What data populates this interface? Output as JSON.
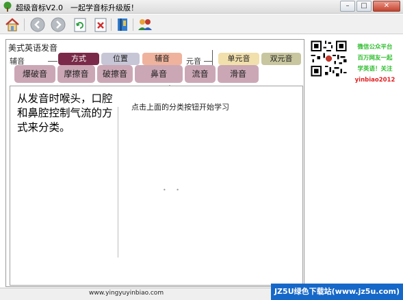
{
  "window": {
    "title": "超级音标V2.0　一起学音标升级版！",
    "minimize": "–",
    "maximize": "□",
    "close": "✕"
  },
  "toolbar": {
    "icons": [
      "home-icon",
      "back-icon",
      "forward-icon",
      "refresh-icon",
      "delete-icon",
      "book-icon",
      "users-icon"
    ]
  },
  "panel": {
    "section_title": "美式英语发音",
    "consonant_label": "辅音",
    "vowel_label": "元音",
    "consonant_tabs": [
      "方式",
      "位置",
      "辅音"
    ],
    "vowel_tabs": [
      "单元音",
      "双元音"
    ],
    "manner_buttons": [
      "爆破音",
      "摩擦音",
      "破擦音",
      "鼻音",
      "流音",
      "滑音"
    ]
  },
  "content": {
    "description": "从发音时喉头，口腔和鼻腔控制气流的方式来分类。",
    "hint": "点击上面的分类按钮开始学习"
  },
  "promo": {
    "line1": "微信公众平台",
    "line2": "百万网友一起",
    "line3": "学英语！关注",
    "line4": "yinbiao2012"
  },
  "status": {
    "url": "www.yingyuyinbiao.com"
  },
  "watermark": {
    "text": "JZ5U绿色下载站(www.jz5u.com)"
  },
  "colors": {
    "fangshi": "#7a2a48",
    "weizhi": "#c7c6d6",
    "fuyin": "#efb39d",
    "danyuan": "#f1dfac",
    "shuangyuan": "#c8c69e",
    "manner": "#cba7b5"
  }
}
